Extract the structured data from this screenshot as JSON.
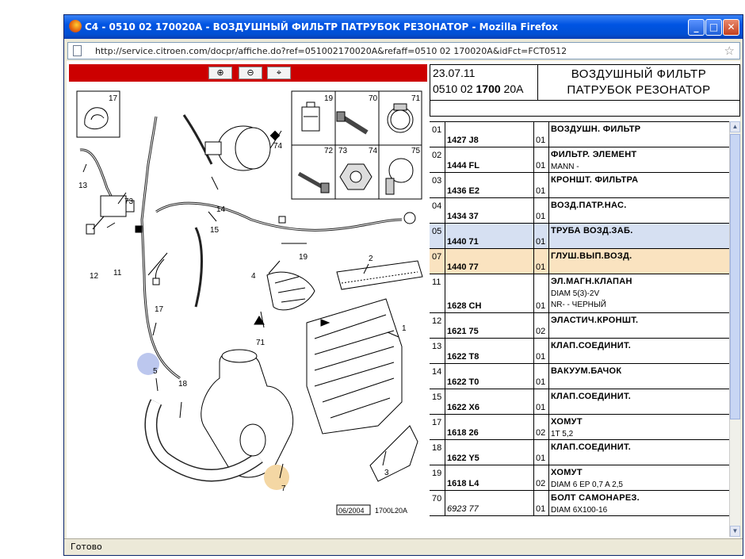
{
  "window": {
    "title": "C4 - 0510 02 170020A - ВОЗДУШНЫЙ ФИЛЬТР ПАТРУБОК РЕЗОНАТОР - Mozilla Firefox",
    "url": "http://service.citroen.com/docpr/affiche.do?ref=051002170020A&refaff=0510 02 170020A&idFct=FCT0512",
    "status": "Готово"
  },
  "toolbar": {
    "zoom_in_icon": "⊕",
    "zoom_out_icon": "⊖",
    "pan_icon": "⌖"
  },
  "header": {
    "date": "23.07.11",
    "ref_a": "0510 02 ",
    "ref_b": "1700",
    "ref_c": " 20A",
    "title_line1": "ВОЗДУШНЫЙ ФИЛЬТР",
    "title_line2": "ПАТРУБОК РЕЗОНАТОР"
  },
  "diagram": {
    "callouts": [
      "1",
      "2",
      "3",
      "4",
      "5",
      "7",
      "11",
      "12",
      "13",
      "14",
      "15",
      "17",
      "18",
      "19",
      "71",
      "73",
      "74"
    ],
    "inset_labels": [
      "17",
      "19",
      "70",
      "71",
      "72",
      "73",
      "74",
      "75"
    ],
    "stamp_date": "06/2004",
    "stamp_code": "1700L20A"
  },
  "parts": [
    {
      "idx": "01",
      "ref": "1427 J8",
      "qty": "01",
      "name": "ВОЗДУШН. ФИЛЬТР",
      "d1": "",
      "d2": ""
    },
    {
      "idx": "02",
      "ref": "1444 FL",
      "qty": "01",
      "name": "ФИЛЬТР. ЭЛЕМЕНТ",
      "d1": "MANN -",
      "d2": ""
    },
    {
      "idx": "03",
      "ref": "1436 E2",
      "qty": "01",
      "name": "КРОНШТ. ФИЛЬТРА",
      "d1": "",
      "d2": ""
    },
    {
      "idx": "04",
      "ref": "1434 37",
      "qty": "01",
      "name": "ВОЗД.ПАТР.НАС.",
      "d1": "",
      "d2": ""
    },
    {
      "idx": "05",
      "ref": "1440 71",
      "qty": "01",
      "name": "ТРУБА ВОЗД.ЗАБ.",
      "d1": "",
      "d2": ""
    },
    {
      "idx": "07",
      "ref": "1440 77",
      "qty": "01",
      "name": "ГЛУШ.ВЫП.ВОЗД.",
      "d1": "",
      "d2": ""
    },
    {
      "idx": "11",
      "ref": "1628 CH",
      "qty": "01",
      "name": "ЭЛ.МАГН.КЛАПАН",
      "d1": "DIAM 5(3)-2V",
      "d2": "NR- - ЧЕРНЫЙ"
    },
    {
      "idx": "12",
      "ref": "1621 75",
      "qty": "02",
      "name": "ЭЛАСТИЧ.КРОНШТ.",
      "d1": "",
      "d2": ""
    },
    {
      "idx": "13",
      "ref": "1622 T8",
      "qty": "01",
      "name": "КЛАП.СОЕДИНИТ.",
      "d1": "",
      "d2": ""
    },
    {
      "idx": "14",
      "ref": "1622 T0",
      "qty": "01",
      "name": "ВАКУУМ.БАЧОК",
      "d1": "",
      "d2": ""
    },
    {
      "idx": "15",
      "ref": "1622 X6",
      "qty": "01",
      "name": "КЛАП.СОЕДИНИТ.",
      "d1": "",
      "d2": ""
    },
    {
      "idx": "17",
      "ref": "1618 26",
      "qty": "02",
      "name": "ХОМУТ",
      "d1": "1T 5,2",
      "d2": ""
    },
    {
      "idx": "18",
      "ref": "1622 Y5",
      "qty": "01",
      "name": "КЛАП.СОЕДИНИТ.",
      "d1": "",
      "d2": ""
    },
    {
      "idx": "19",
      "ref": "1618 L4",
      "qty": "02",
      "name": "ХОМУТ",
      "d1": "DIAM 6 EP 0,7 A 2,5",
      "d2": ""
    },
    {
      "idx": "70",
      "ref": "6923 77",
      "qty": "01",
      "name": "БОЛТ САМОНАРЕЗ.",
      "d1": "DIAM 6X100-16",
      "d2": ""
    }
  ]
}
